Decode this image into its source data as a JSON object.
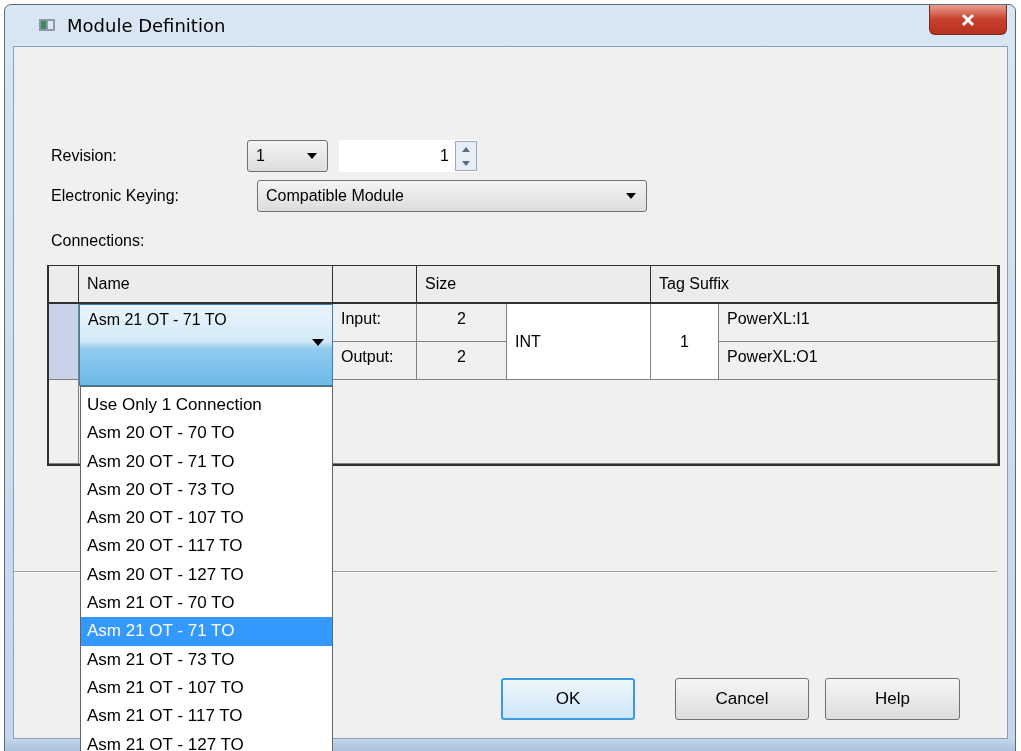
{
  "window": {
    "title": "Module Definition"
  },
  "revision": {
    "label": "Revision:",
    "major": "1",
    "minor": "1"
  },
  "keying": {
    "label": "Electronic Keying:",
    "value": "Compatible Module"
  },
  "connections": {
    "label": "Connections:",
    "columns": [
      "Name",
      "Size",
      "Tag Suffix"
    ],
    "row": {
      "name": "Asm 21 OT - 71 TO",
      "input_label": "Input:",
      "input_size": "2",
      "output_label": "Output:",
      "output_size": "2",
      "type": "INT",
      "instance": "1",
      "input_tag": "PowerXL:I1",
      "output_tag": "PowerXL:O1"
    }
  },
  "dropdown": {
    "options": [
      {
        "label": "Use Only 1 Connection",
        "selected": false
      },
      {
        "label": "Asm 20 OT - 70 TO",
        "selected": false
      },
      {
        "label": "Asm 20 OT - 71 TO",
        "selected": false
      },
      {
        "label": "Asm 20 OT - 73 TO",
        "selected": false
      },
      {
        "label": "Asm 20 OT - 107 TO",
        "selected": false
      },
      {
        "label": "Asm 20 OT - 117 TO",
        "selected": false
      },
      {
        "label": "Asm 20 OT - 127 TO",
        "selected": false
      },
      {
        "label": "Asm 21 OT - 70 TO",
        "selected": false
      },
      {
        "label": "Asm 21 OT - 71 TO",
        "selected": true
      },
      {
        "label": "Asm 21 OT - 73 TO",
        "selected": false
      },
      {
        "label": "Asm 21 OT - 107 TO",
        "selected": false
      },
      {
        "label": "Asm 21 OT - 117 TO",
        "selected": false
      },
      {
        "label": "Asm 21 OT - 127 TO",
        "selected": false
      }
    ]
  },
  "buttons": [
    {
      "label": "OK",
      "default": true
    },
    {
      "label": "Cancel",
      "default": false
    },
    {
      "label": "Help",
      "default": false
    }
  ]
}
